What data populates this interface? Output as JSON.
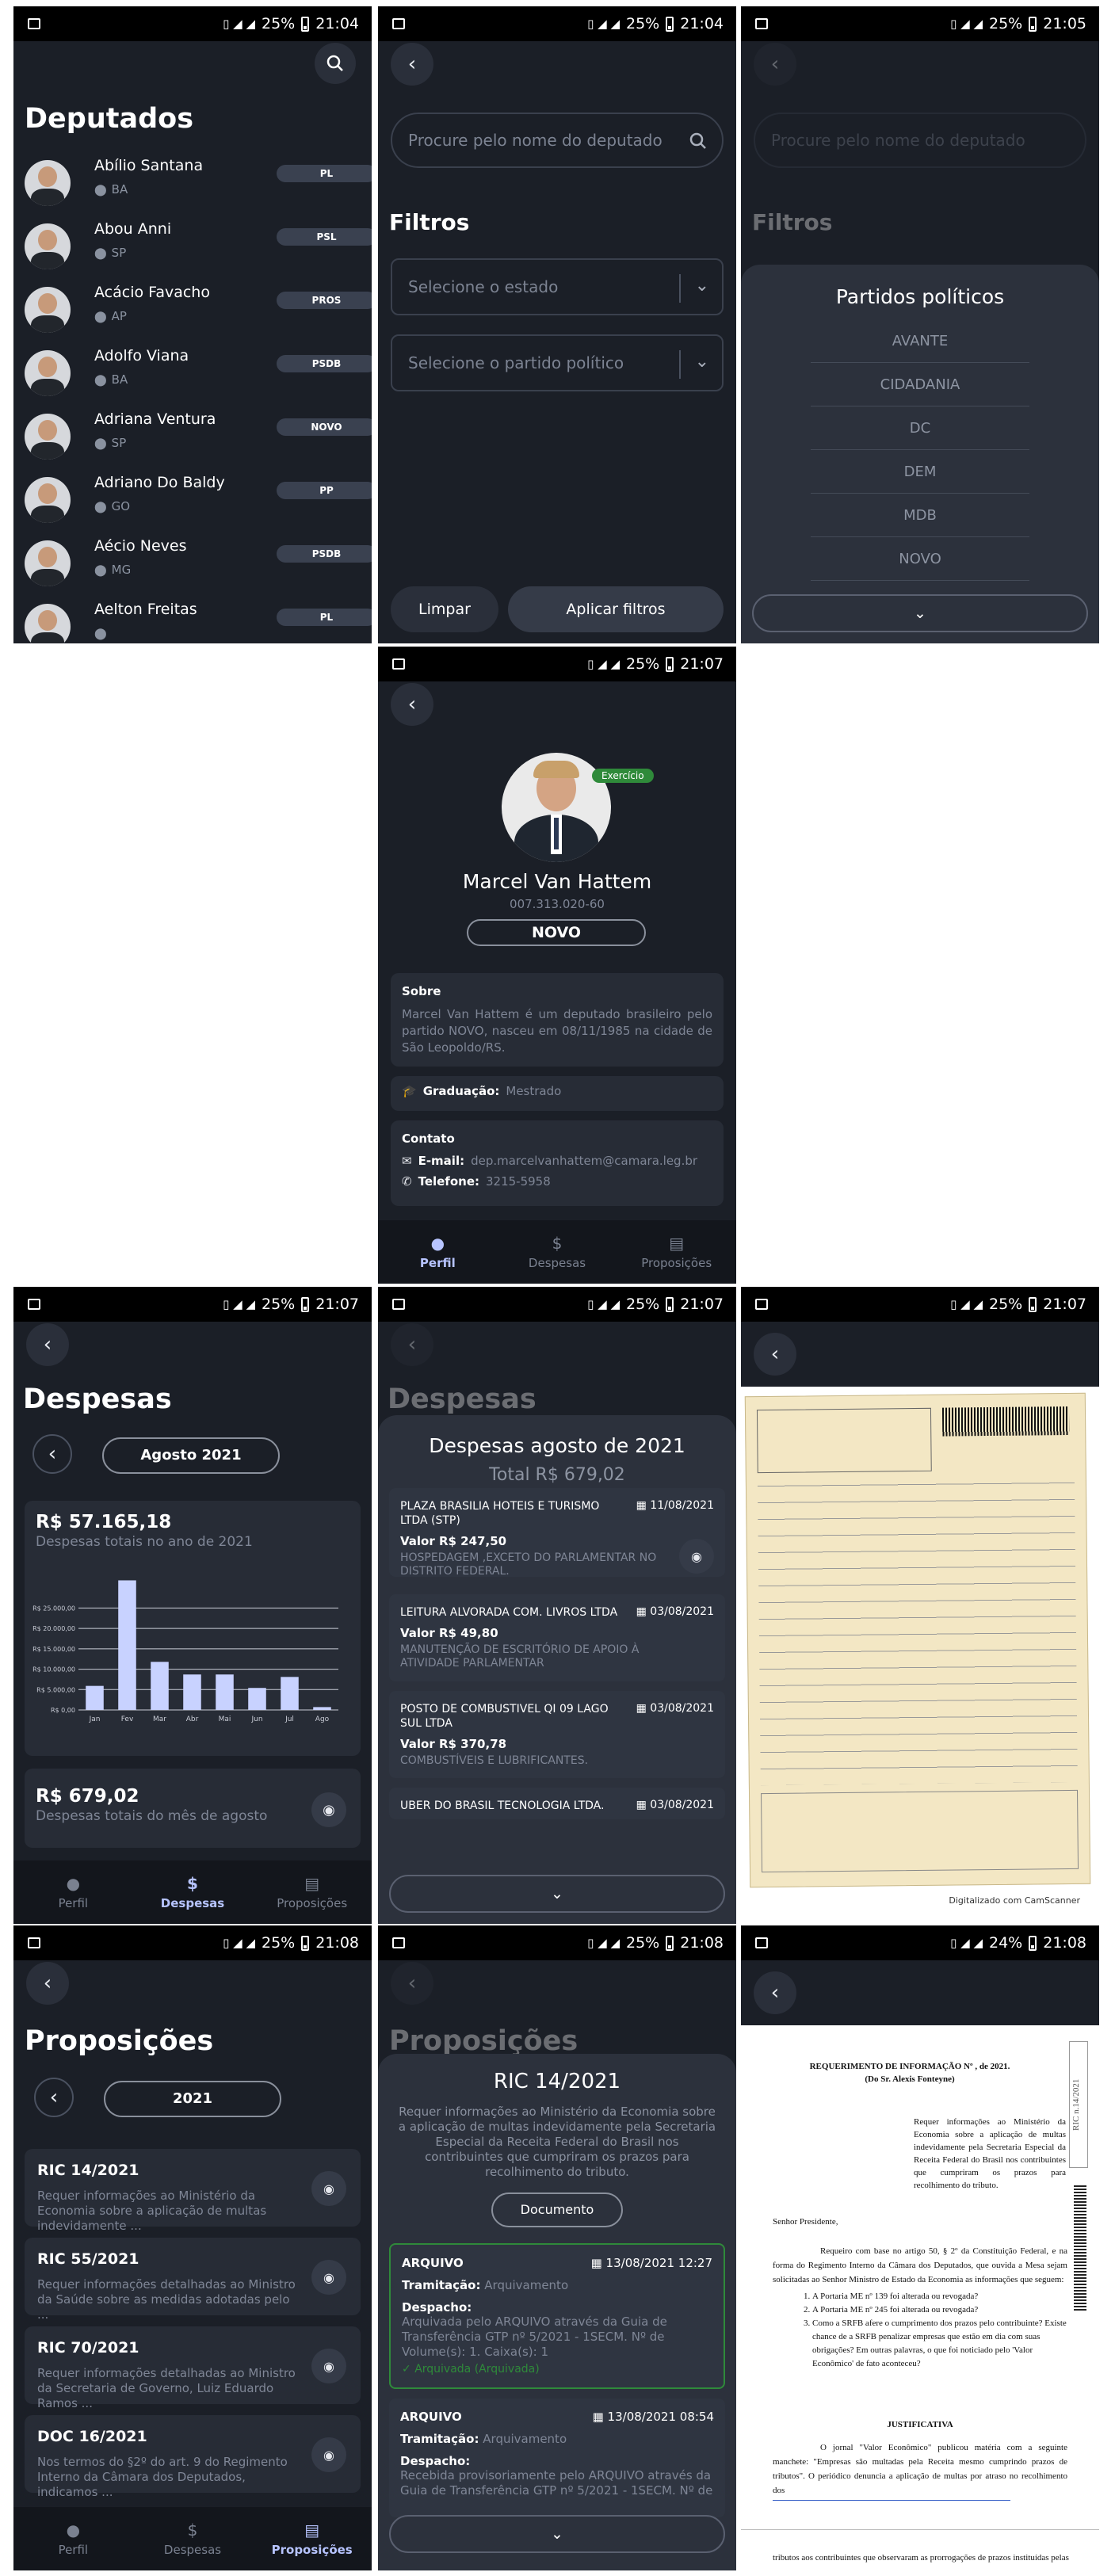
{
  "status": {
    "s1": {
      "battery": "25%",
      "time": "21:04"
    },
    "s2": {
      "battery": "25%",
      "time": "21:04"
    },
    "s3": {
      "battery": "25%",
      "time": "21:05"
    },
    "s4": {
      "battery": "25%",
      "time": "21:07"
    },
    "s5": {
      "battery": "25%",
      "time": "21:07"
    },
    "s6": {
      "battery": "25%",
      "time": "21:07"
    },
    "s7": {
      "battery": "25%",
      "time": "21:07"
    },
    "s8": {
      "battery": "25%",
      "time": "21:08"
    },
    "s9": {
      "battery": "25%",
      "time": "21:08"
    },
    "s10": {
      "battery": "24%",
      "time": "21:08"
    },
    "network": "4G"
  },
  "deputados": {
    "title": "Deputados",
    "items": [
      {
        "name": "Abílio Santana",
        "uf": "BA",
        "party": "PL"
      },
      {
        "name": "Abou Anni",
        "uf": "SP",
        "party": "PSL"
      },
      {
        "name": "Acácio Favacho",
        "uf": "AP",
        "party": "PROS"
      },
      {
        "name": "Adolfo Viana",
        "uf": "BA",
        "party": "PSDB"
      },
      {
        "name": "Adriana Ventura",
        "uf": "SP",
        "party": "NOVO"
      },
      {
        "name": "Adriano Do Baldy",
        "uf": "GO",
        "party": "PP"
      },
      {
        "name": "Aécio Neves",
        "uf": "MG",
        "party": "PSDB"
      },
      {
        "name": "Aelton Freitas",
        "uf": "",
        "party": "PL"
      }
    ]
  },
  "filters": {
    "search_placeholder": "Procure pelo nome do deputado",
    "title": "Filtros",
    "state_placeholder": "Selecione o estado",
    "party_placeholder": "Selecione o partido político",
    "clear": "Limpar",
    "apply": "Aplicar filtros",
    "sheet_title": "Partidos políticos",
    "parties": [
      "AVANTE",
      "CIDADANIA",
      "DC",
      "DEM",
      "MDB",
      "NOVO"
    ]
  },
  "profile": {
    "badge": "Exercício",
    "name": "Marcel Van Hattem",
    "cpf": "007.313.020-60",
    "party": "NOVO",
    "about_title": "Sobre",
    "about_text": "Marcel Van Hattem é um deputado brasileiro pelo partido NOVO, nasceu em 08/11/1985 na cidade de São Leopoldo/RS.",
    "grad_label": "Graduação:",
    "grad_value": "Mestrado",
    "contact_title": "Contato",
    "email_label": "E-mail:",
    "email_value": "dep.marcelvanhattem@camara.leg.br",
    "phone_label": "Telefone:",
    "phone_value": "3215-5958"
  },
  "tabs": {
    "perfil": "Perfil",
    "despesas": "Despesas",
    "proposicoes": "Proposições"
  },
  "despesas": {
    "title": "Despesas",
    "month": "Agosto 2021",
    "year_total": "R$ 57.165,18",
    "year_caption": "Despesas totais no ano de 2021",
    "month_total": "R$ 679,02",
    "month_caption": "Despesas totais do mês de agosto",
    "sheet_title": "Despesas agosto de 2021",
    "sheet_total": "Total R$ 679,02",
    "items": [
      {
        "vendor": "PLAZA BRASILIA HOTEIS E TURISMO LTDA (STP)",
        "date": "11/08/2021",
        "value": "Valor R$ 247,50",
        "desc": "HOSPEDAGEM ,EXCETO DO PARLAMENTAR NO DISTRITO FEDERAL."
      },
      {
        "vendor": "LEITURA ALVORADA COM. LIVROS LTDA",
        "date": "03/08/2021",
        "value": "Valor R$ 49,80",
        "desc": "MANUTENÇÃO DE ESCRITÓRIO DE APOIO À ATIVIDADE PARLAMENTAR"
      },
      {
        "vendor": "POSTO DE COMBUSTIVEL QI 09 LAGO SUL LTDA",
        "date": "03/08/2021",
        "value": "Valor R$ 370,78",
        "desc": "COMBUSTÍVEIS E LUBRIFICANTES."
      },
      {
        "vendor": "UBER DO BRASIL TECNOLOGIA LTDA.",
        "date": "03/08/2021",
        "value": "",
        "desc": ""
      }
    ],
    "scan_caption": "Digitalizado com CamScanner"
  },
  "chart_data": {
    "type": "bar",
    "categories": [
      "Jan",
      "Fev",
      "Mar",
      "Abr",
      "Mai",
      "Jun",
      "Jul",
      "Ago"
    ],
    "values": [
      5900,
      31800,
      11800,
      8700,
      8700,
      5400,
      8100,
      700
    ],
    "ylim": [
      0,
      35000
    ],
    "yticks": [
      "R$ 0,00",
      "R$ 5.000,00",
      "R$ 10.000,00",
      "R$ 15.000,00",
      "R$ 20.000,00",
      "R$ 25.000,00"
    ],
    "ytick_values": [
      0,
      5000,
      10000,
      15000,
      20000,
      25000
    ],
    "grid": true
  },
  "proposicoes": {
    "title": "Proposições",
    "year": "2021",
    "items": [
      {
        "code": "RIC 14/2021",
        "desc": "Requer informações ao Ministério da Economia sobre a aplicação de multas indevidamente ..."
      },
      {
        "code": "RIC 55/2021",
        "desc": "Requer informações detalhadas ao Ministro da Saúde sobre as medidas adotadas pelo ..."
      },
      {
        "code": "RIC 70/2021",
        "desc": "Requer informações detalhadas ao Ministro da Secretaria de Governo, Luiz Eduardo Ramos ..."
      },
      {
        "code": "DOC 16/2021",
        "desc": "Nos termos do §2º do art. 9 do Regimento Interno da Câmara dos Deputados, indicamos ..."
      }
    ],
    "detail": {
      "code": "RIC 14/2021",
      "ementa": "Requer informações ao Ministério da Economia sobre a aplicação de multas indevidamente pela Secretaria Especial da Receita Federal do Brasil nos contribuintes que cumpriram os prazos para recolhimento do tributo.",
      "doc_button": "Documento",
      "tram": [
        {
          "org": "ARQUIVO",
          "date": "13/08/2021 12:27",
          "tram_label": "Tramitação:",
          "tram_value": "Arquivamento",
          "desp_label": "Despacho:",
          "desp_value": "Arquivada pelo ARQUIVO através da Guia de Transferência GTP nº 5/2021 - 1SECM. Nº de Volume(s): 1. Caixa(s): 1",
          "status": "Arquivada (Arquivada)"
        },
        {
          "org": "ARQUIVO",
          "date": "13/08/2021 08:54",
          "tram_label": "Tramitação:",
          "tram_value": "Arquivamento",
          "desp_label": "Despacho:",
          "desp_value": "Recebida provisoriamente pelo ARQUIVO através da Guia de Transferência GTP nº 5/2021 - 1SECM. Nº de"
        }
      ]
    }
  },
  "document": {
    "heading": "REQUERIMENTO DE INFORMAÇÃO Nº , de 2021.",
    "author": "(Do Sr. Alexis Fonteyne)",
    "ementa": "Requer informações ao Ministério da Economia sobre a aplicação de multas indevidamente pela Secretaria Especial da Receita Federal do Brasil nos contribuintes que cumpriram os prazos para recolhimento do tributo.",
    "salutation": "Senhor Presidente,",
    "body": "Requeiro com base no artigo 50, § 2º da Constituição Federal, e na forma do Regimento Interno da Câmara dos Deputados, que ouvida a Mesa sejam solicitadas ao Senhor Ministro de Estado da Economia as informações que seguem:",
    "questions": [
      "A Portaria ME nº 139 foi alterada ou revogada?",
      "A Portaria ME nº 245 foi alterada ou revogada?",
      "Como a SRFB afere o cumprimento dos prazos pelo contribuinte? Existe chance de a SRFB penalizar empresas que estão em dia com suas obrigações? Em outras palavras, o que foi noticiado pelo 'Valor Econômico' de fato aconteceu?"
    ],
    "justificativa": "JUSTIFICATIVA",
    "just_text": "O jornal \"Valor Econômico\" publicou matéria com a seguinte manchete: \"Empresas são multadas pela Receita mesmo cumprindo prazos de tributos\". O periódico denuncia a aplicação de multas por atraso no recolhimento dos",
    "footer": "tributos aos contribuintes que observaram as prorrogações de prazos instituídas pelas",
    "side_code": "RIC n.14/2021"
  },
  "colors": {
    "bg": "#1b1f27",
    "card": "#272c36",
    "accent": "#b7c4ff",
    "green": "#2f8a3a"
  }
}
